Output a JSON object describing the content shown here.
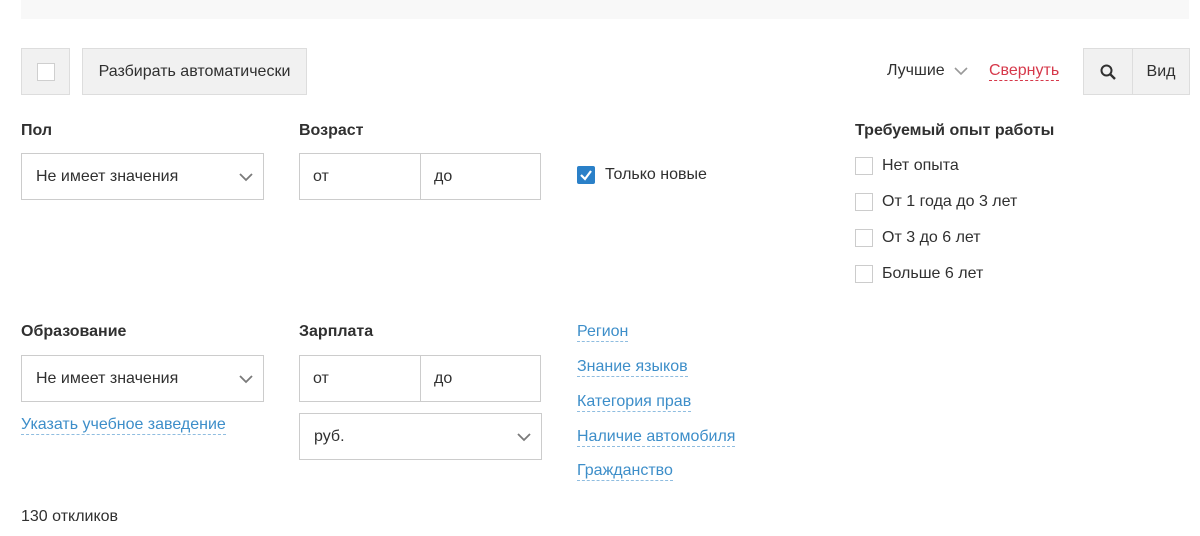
{
  "toolbar": {
    "auto_sort_label": "Разбирать автоматически",
    "sort_label": "Лучшие",
    "collapse_label": "Свернуть",
    "view_label": "Вид"
  },
  "filters": {
    "gender": {
      "label": "Пол",
      "value": "Не имеет значения"
    },
    "age": {
      "label": "Возраст",
      "from_placeholder": "от",
      "to_placeholder": "до"
    },
    "only_new": {
      "label": "Только новые",
      "checked": true
    },
    "experience": {
      "label": "Требуемый опыт работы",
      "options": [
        "Нет опыта",
        "От 1 года до 3 лет",
        "От 3 до 6 лет",
        "Больше 6 лет"
      ]
    },
    "education": {
      "label": "Образование",
      "value": "Не имеет значения",
      "link": "Указать учебное заведение"
    },
    "salary": {
      "label": "Зарплата",
      "from_placeholder": "от",
      "to_placeholder": "до",
      "currency": "руб."
    },
    "extra_links": [
      "Регион",
      "Знание языков",
      "Категория прав",
      "Наличие автомобиля",
      "Гражданство"
    ]
  },
  "summary": {
    "responses": "130 откликов"
  },
  "colors": {
    "accent": "#2a80c8",
    "link": "#3d8ec9",
    "collapse": "#d6384a"
  }
}
